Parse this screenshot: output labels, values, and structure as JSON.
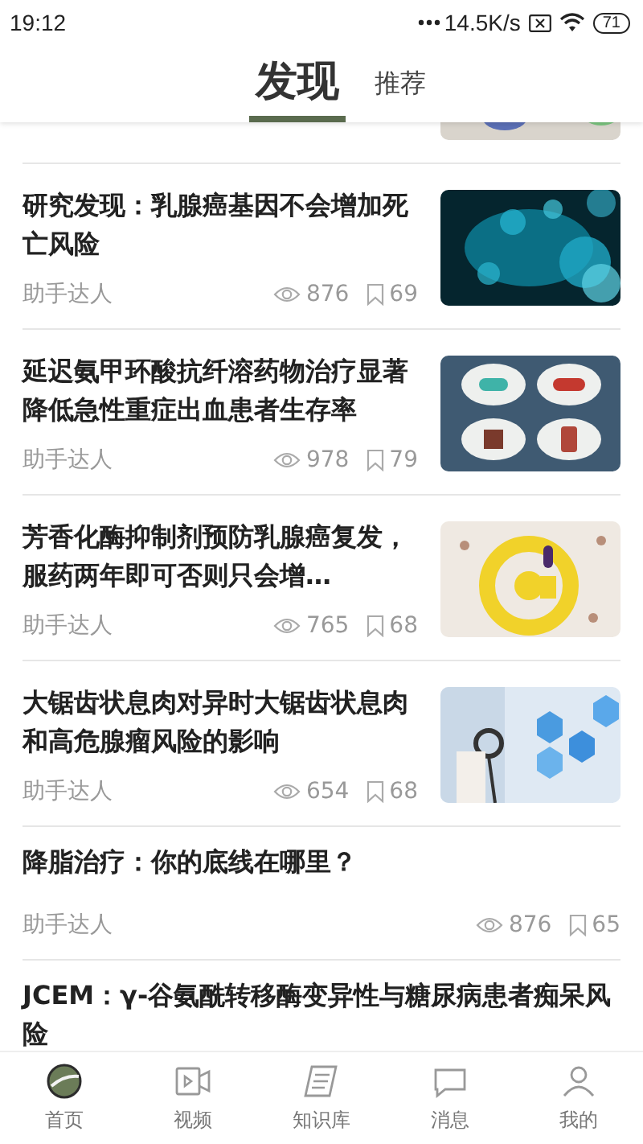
{
  "status_bar": {
    "time": "19:12",
    "speed": "14.5K/s",
    "battery": "71"
  },
  "tabs": [
    {
      "label": "发现",
      "selected": true
    },
    {
      "label": "推荐",
      "selected": false
    }
  ],
  "articles": [
    {
      "kind": "picture"
    },
    {
      "kind": "picture",
      "title": "研究发现：乳腺癌基因不会增加死亡风险",
      "author": "助手达人",
      "views": "876",
      "saves": "69"
    },
    {
      "kind": "picture",
      "title": "延迟氨甲环酸抗纤溶药物治疗显著降低急性重症出血患者生存率",
      "author": "助手达人",
      "views": "978",
      "saves": "79"
    },
    {
      "kind": "picture",
      "title": "芳香化酶抑制剂预防乳腺癌复发，服药两年即可否则只会增…",
      "author": "助手达人",
      "views": "765",
      "saves": "68"
    },
    {
      "kind": "picture",
      "title": "大锯齿状息肉对异时大锯齿状息肉和高危腺瘤风险的影响",
      "author": "助手达人",
      "views": "654",
      "saves": "68"
    },
    {
      "kind": "text",
      "title": "降脂治疗：你的底线在哪里？",
      "author": "助手达人",
      "views": "876",
      "saves": "65"
    },
    {
      "kind": "text",
      "title": "JCEM：γ-谷氨酰转移酶变异性与糖尿病患者痴呆风险"
    }
  ],
  "nav": [
    {
      "label": "首页",
      "selected": true
    },
    {
      "label": "视频",
      "selected": false
    },
    {
      "label": "知识库",
      "selected": false
    },
    {
      "label": "消息",
      "selected": false
    },
    {
      "label": "我的",
      "selected": false
    }
  ]
}
